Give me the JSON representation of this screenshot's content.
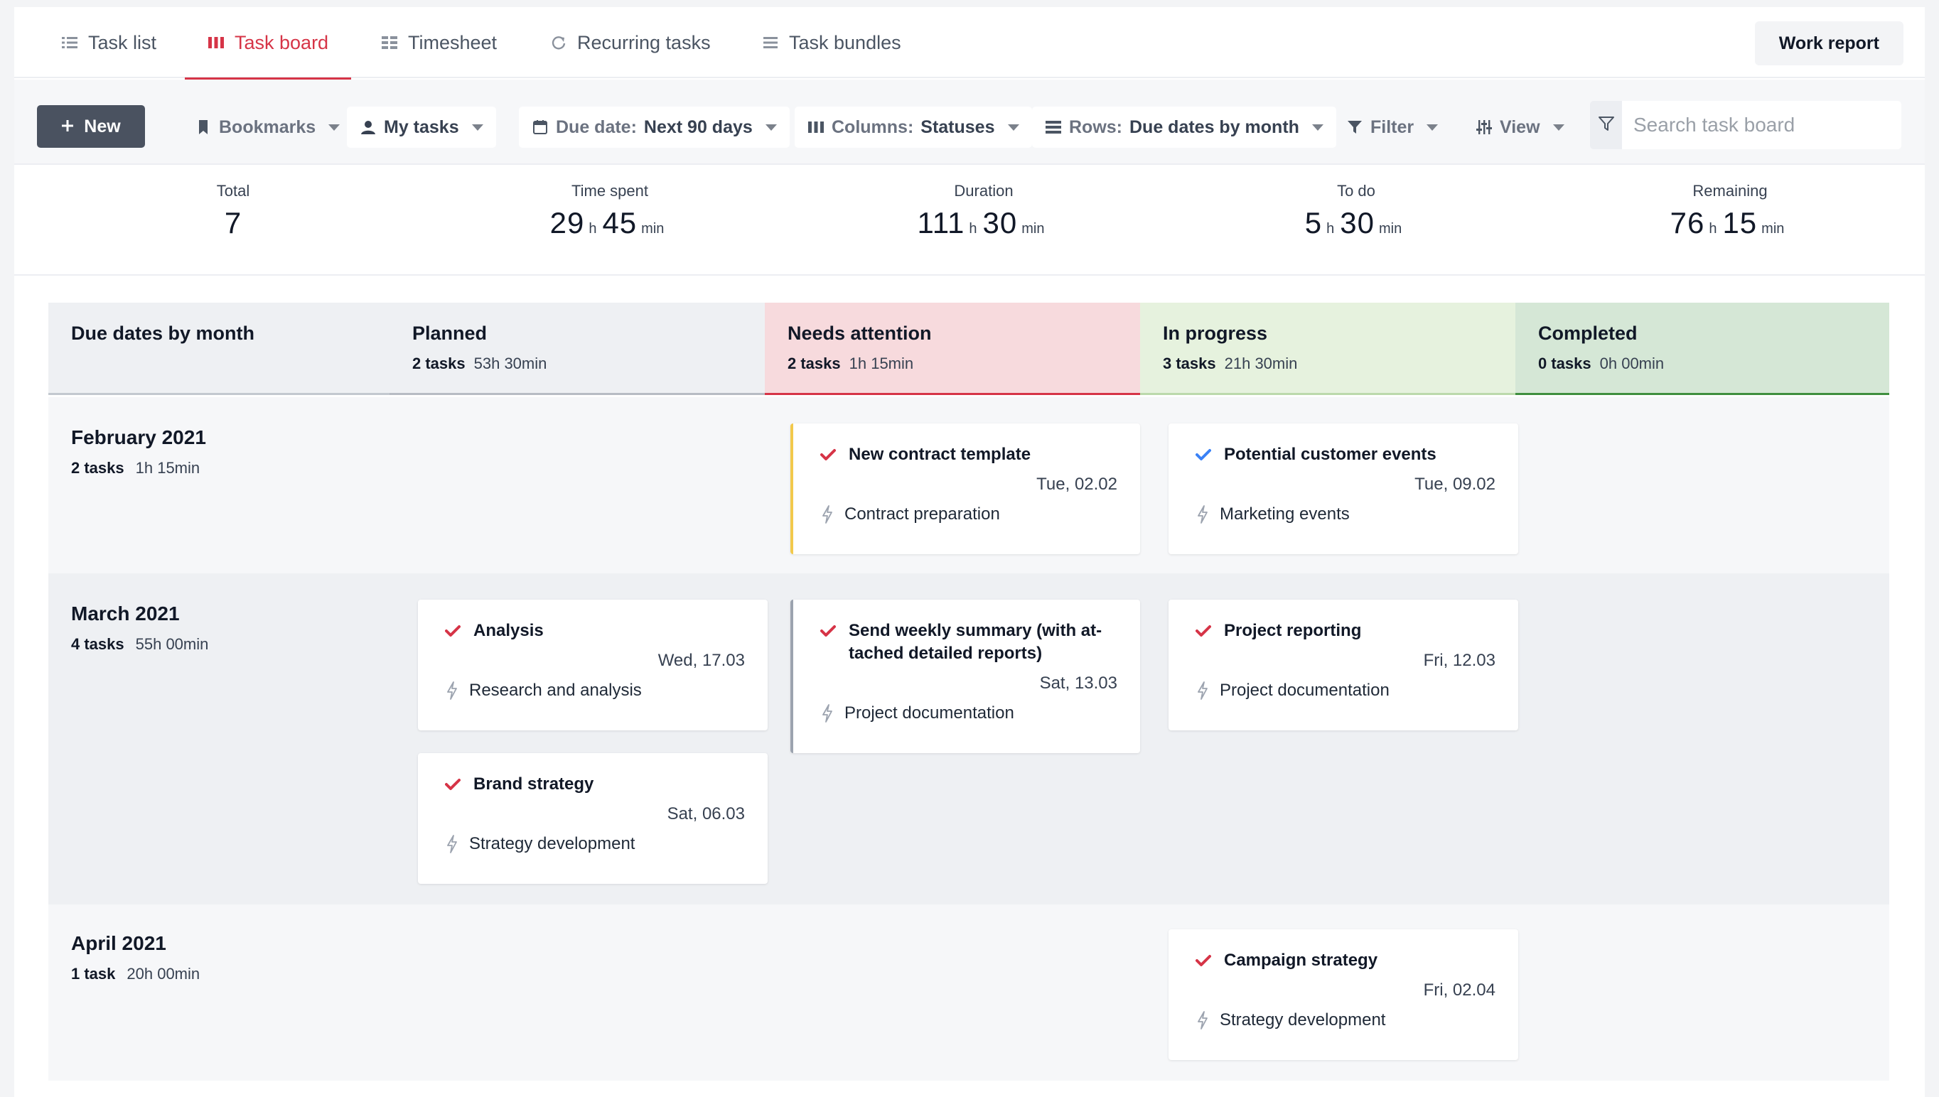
{
  "tabs": [
    {
      "label": "Task list",
      "icon": "list-icon"
    },
    {
      "label": "Task board",
      "icon": "board-icon",
      "active": true
    },
    {
      "label": "Timesheet",
      "icon": "grid-icon"
    },
    {
      "label": "Recurring tasks",
      "icon": "refresh-icon"
    },
    {
      "label": "Task bundles",
      "icon": "stack-icon"
    }
  ],
  "work_report_label": "Work report",
  "toolbar": {
    "new_label": "New",
    "bookmarks_label": "Bookmarks",
    "my_tasks_label": "My tasks",
    "due_date_prefix": "Due date:",
    "due_date_value": "Next 90 days",
    "columns_prefix": "Columns:",
    "columns_value": "Statuses",
    "rows_prefix": "Rows:",
    "rows_value": "Due dates by month",
    "filter_label": "Filter",
    "view_label": "View",
    "search_placeholder": "Search task board"
  },
  "stats": {
    "total": {
      "label": "Total",
      "value": "7"
    },
    "time_spent": {
      "label": "Time spent",
      "hours": "29",
      "minutes": "45"
    },
    "duration": {
      "label": "Duration",
      "hours": "111",
      "minutes": "30"
    },
    "to_do": {
      "label": "To do",
      "hours": "5",
      "minutes": "30"
    },
    "remaining": {
      "label": "Remaining",
      "hours": "76",
      "minutes": "15"
    },
    "unit_h": "h",
    "unit_min": "min"
  },
  "board": {
    "row_header_title": "Due dates by month",
    "columns": [
      {
        "title": "Planned",
        "count": "2 tasks",
        "time": "53h 30min",
        "bg": "#eef0f3",
        "border": "#b7bcc4"
      },
      {
        "title": "Needs attention",
        "count": "2 tasks",
        "time": "1h 15min",
        "bg": "#f7dadd",
        "border": "#d63447"
      },
      {
        "title": "In progress",
        "count": "3 tasks",
        "time": "21h 30min",
        "bg": "#e6f2de",
        "border": "#bcd9ac"
      },
      {
        "title": "Completed",
        "count": "0 tasks",
        "time": "0h 00min",
        "bg": "#d5e7d6",
        "border": "#3f8f3f"
      }
    ],
    "rows": [
      {
        "title": "February 2021",
        "count": "2 tasks",
        "time": "1h 15min"
      },
      {
        "title": "March 2021",
        "count": "4 tasks",
        "time": "55h 00min"
      },
      {
        "title": "April 2021",
        "count": "1 task",
        "time": "20h 00min"
      }
    ],
    "cards": {
      "new_contract": {
        "title": "New contract template",
        "date": "Tue, 02.02",
        "project": "Contract preparation"
      },
      "potential_customer": {
        "title": "Potential customer events",
        "date": "Tue, 09.02",
        "project": "Marketing events"
      },
      "analysis": {
        "title": "Analysis",
        "date": "Wed, 17.03",
        "project": "Research and analysis"
      },
      "brand_strategy": {
        "title": "Brand strategy",
        "date": "Sat, 06.03",
        "project": "Strategy development"
      },
      "weekly_summary": {
        "title": "Send weekly summary (with at-tached detailed reports)",
        "date": "Sat, 13.03",
        "project": "Project documentation"
      },
      "project_reporting": {
        "title": "Project reporting",
        "date": "Fri, 12.03",
        "project": "Project documentation"
      },
      "campaign_strategy": {
        "title": "Campaign strategy",
        "date": "Fri, 02.04",
        "project": "Strategy development"
      }
    }
  },
  "colors": {
    "accent": "#d63447",
    "check_red": "#d63447",
    "check_blue": "#3b82f6"
  }
}
